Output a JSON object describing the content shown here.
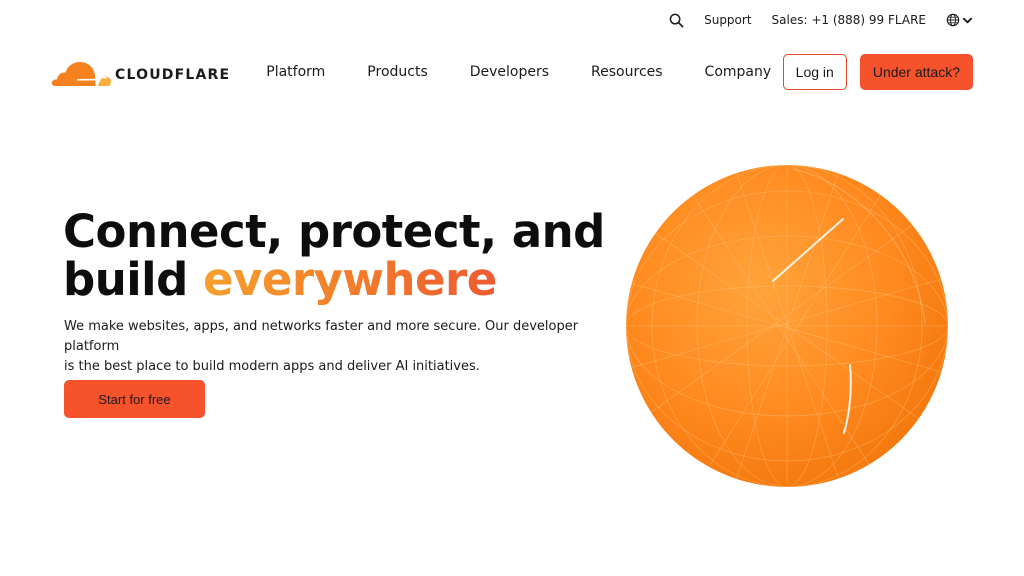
{
  "utility": {
    "search_icon": "search-icon",
    "support_label": "Support",
    "sales_label": "Sales: +1 (888) 99 FLARE",
    "language_icon": "globe-icon"
  },
  "nav": {
    "logo_text": "CLOUDFLARE",
    "links": [
      "Platform",
      "Products",
      "Developers",
      "Resources",
      "Company"
    ],
    "login_label": "Log in",
    "attack_label": "Under attack?"
  },
  "hero": {
    "title_line1": "Connect, protect, and",
    "title_line2_prefix": "build ",
    "title_line2_accent": "everywhere",
    "description_line1": "We make websites, apps, and networks faster and more secure. Our developer platform",
    "description_line2": "is the best place to build modern apps and deliver AI initiatives.",
    "cta_label": "Start for free"
  },
  "colors": {
    "brand_orange": "#f6821f",
    "cta_red_orange": "#f6522c",
    "accent_gradient_start": "#f6a02e",
    "accent_gradient_end": "#ee5a32",
    "globe_orange": "#ff8a1f"
  }
}
